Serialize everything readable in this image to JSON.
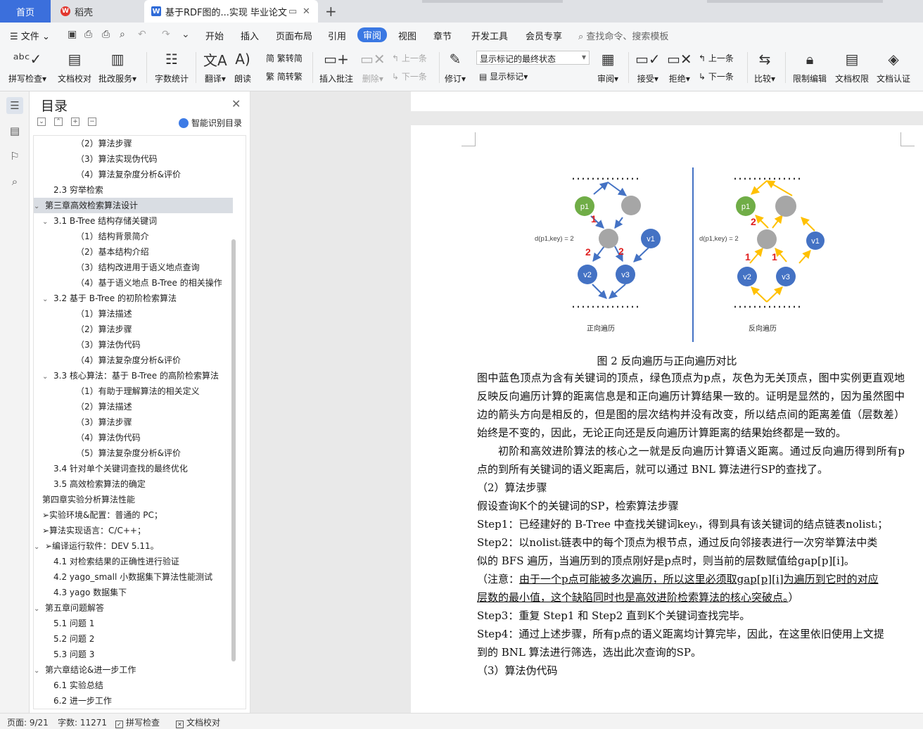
{
  "tabs": {
    "home": "首页",
    "wps": "稻壳",
    "doc": "基于RDF图的...实现 毕业论文"
  },
  "menu": {
    "file": "文件",
    "items": [
      "开始",
      "插入",
      "页面布局",
      "引用",
      "审阅",
      "视图",
      "章节",
      "开发工具",
      "会员专享"
    ],
    "search": "查找命令、搜索模板"
  },
  "ribbon": {
    "spell": "拼写检查",
    "proof": "文档校对",
    "annotate_service": "批改服务",
    "word_count": "字数统计",
    "translate": "翻译",
    "read_aloud": "朗读",
    "trad_to_simp": "繁转简",
    "simp_to_trad": "简转繁",
    "insert_comment": "插入批注",
    "delete": "删除",
    "prev_comment": "上一条",
    "next_comment": "下一条",
    "track": "修订",
    "markup_state": "显示标记的最终状态",
    "show_markup": "显示标记",
    "review_pane": "审阅",
    "accept": "接受",
    "reject": "拒绝",
    "prev_change": "上一条",
    "next_change": "下一条",
    "compare": "比较",
    "restrict": "限制编辑",
    "doc_rights": "文档权限",
    "doc_cert": "文档认证"
  },
  "toc": {
    "title": "目录",
    "smart": "智能识别目录",
    "items": [
      {
        "text": "（2）算法步骤",
        "level": 3
      },
      {
        "text": "（3）算法实现伪代码",
        "level": 3
      },
      {
        "text": "（4）算法复杂度分析&评价",
        "level": 3
      },
      {
        "text": "2.3 穷举检索",
        "level": 2
      },
      {
        "text": "第三章高效检索算法设计",
        "level": 1,
        "caret": true,
        "selected": true
      },
      {
        "text": "3.1 B-Tree 结构存储关键词",
        "level": 2,
        "caret": true
      },
      {
        "text": "（1）结构背景简介",
        "level": 3
      },
      {
        "text": "（2）基本结构介绍",
        "level": 3
      },
      {
        "text": "（3）结构改进用于语义地点查询",
        "level": 3
      },
      {
        "text": "（4）基于语义地点 B-Tree 的相关操作",
        "level": 3
      },
      {
        "text": "3.2 基于 B-Tree 的初阶检索算法",
        "level": 2,
        "caret": true
      },
      {
        "text": "（1）算法描述",
        "level": 3
      },
      {
        "text": "（2）算法步骤",
        "level": 3
      },
      {
        "text": "（3）算法伪代码",
        "level": 3
      },
      {
        "text": "（4）算法复杂度分析&评价",
        "level": 3
      },
      {
        "text": "3.3 核心算法：基于 B-Tree 的高阶检索算法",
        "level": 2,
        "caret": true
      },
      {
        "text": "（1）有助于理解算法的相关定义",
        "level": 3
      },
      {
        "text": "（2）算法描述",
        "level": 3
      },
      {
        "text": "（3）算法步骤",
        "level": 3
      },
      {
        "text": "（4）算法伪代码",
        "level": 3
      },
      {
        "text": "（5）算法复杂度分析&评价",
        "level": 3
      },
      {
        "text": "3.4 针对单个关键词查找的最终优化",
        "level": 2
      },
      {
        "text": "3.5 高效检索算法的确定",
        "level": 2
      },
      {
        "text": "第四章实验分析算法性能",
        "level": 1
      },
      {
        "text": "➢实验环境&配置：普通的 PC；",
        "level": 1
      },
      {
        "text": "➢算法实现语言：C/C++；",
        "level": 1
      },
      {
        "text": "➢编译运行软件：DEV 5.11。",
        "level": 1,
        "caret": true
      },
      {
        "text": "4.1 对检索结果的正确性进行验证",
        "level": 2
      },
      {
        "text": "4.2  yago_small 小数据集下算法性能测试",
        "level": 2
      },
      {
        "text": "4.3 yago 数据集下",
        "level": 2
      },
      {
        "text": "第五章问题解答",
        "level": 1,
        "caret": true
      },
      {
        "text": "5.1 问题 1",
        "level": 2
      },
      {
        "text": "5.2 问题 2",
        "level": 2
      },
      {
        "text": "5.3 问题 3",
        "level": 2
      },
      {
        "text": "第六章结论&进一步工作",
        "level": 1,
        "caret": true
      },
      {
        "text": "6.1 实验总结",
        "level": 2
      },
      {
        "text": "6.2 进一步工作",
        "level": 2
      }
    ]
  },
  "figure": {
    "left": {
      "nodes": [
        "p1",
        "v1",
        "v2",
        "v3"
      ],
      "distance_label": "d(p1,key) = 2",
      "edge_labels": [
        "1",
        "2",
        "2"
      ],
      "caption": "正向遍历"
    },
    "right": {
      "nodes": [
        "p1",
        "v1",
        "v2",
        "v3"
      ],
      "distance_label": "d(p1,key) = 2",
      "edge_labels": [
        "2",
        "1",
        "1"
      ],
      "caption": "反向遍历"
    },
    "colors": {
      "blue_node": "#4472c4",
      "green_node": "#70ad47",
      "gray_node": "#a6a6a6",
      "forward_edge": "#4472c4",
      "backward_edge": "#ffc000",
      "divider": "#4472c4",
      "edge_label": "#e02020"
    }
  },
  "doc": {
    "fig_caption": "图 2 反向遍历与正向遍历对比",
    "p1": "图中蓝色顶点为含有关键词的顶点，绿色顶点为p点，灰色为无关顶点，图中实例更直观地反映反向遍历计算的距离信息是和正向遍历计算结果一致的。证明是显然的，因为虽然图中边的箭头方向是相反的，但是图的层次结构并没有改变，所以结点间的距离差值（层数差）始终是不变的，因此，无论正向还是反向遍历计算距离的结果始终都是一致的。",
    "p2": "初阶和高效进阶算法的核心之一就是反向遍历计算语义距离。通过反向遍历得到所有p点的到所有关键词的语义距离后，就可以通过 BNL 算法进行SP的查找了。",
    "h_steps": "（2）算法步骤",
    "intro": "假设查询K个的关键词的SP，检索算法步骤",
    "step1": "Step1：已经建好的 B-Tree 中查找关键词keyᵢ，得到具有该关键词的结点链表nolistᵢ；",
    "step2a": "Step2：以nolistᵢ链表中的每个顶点为根节点，通过反向邻接表进行一次穷举算法中类",
    "step2b": "似的 BFS 遍历，当遍历到的顶点刚好是p点时，则当前的层数赋值给gap[p][i]。",
    "note_a_pre": "（注意：",
    "note_a": "由于一个p点可能被多次遍历，所以这里必须取gap[p][i]为遍历到它时的对应",
    "note_b": "层数的最小值，这个缺陷同时也是高效进阶检索算法的核心突破点。",
    "note_b_post": "）",
    "step3": "Step3：重复 Step1 和 Step2 直到K个关键词查找完毕。",
    "step4a": "Step4：通过上述步骤，所有p点的语义距离均计算完毕，因此，在这里依旧使用上文提",
    "step4b": "到的 BNL 算法进行筛选，选出此次查询的SP。",
    "h_pseudo": "（3）算法伪代码"
  },
  "status": {
    "page": "页面: 9/21",
    "words": "字数: 11271",
    "spell": "拼写检查",
    "proof": "文档校对"
  }
}
